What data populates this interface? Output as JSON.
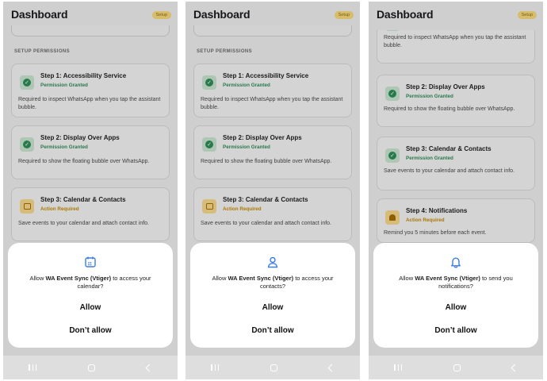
{
  "header": {
    "title": "Dashboard",
    "badge": "Setup"
  },
  "section_label": "SETUP PERMISSIONS",
  "steps": {
    "s1": {
      "title": "Step 1: Accessibility Service",
      "desc": "Required to inspect WhatsApp when you tap the assistant bubble."
    },
    "s2": {
      "title": "Step 2: Display Over Apps",
      "desc": "Required to show the floating bubble over WhatsApp."
    },
    "s3": {
      "title": "Step 3: Calendar & Contacts",
      "desc": "Save events to your calendar and attach contact info."
    },
    "s4": {
      "title": "Step 4: Notifications",
      "desc": "Remind you 5 minutes before each event."
    }
  },
  "status": {
    "granted": "Permission Granted",
    "required": "Action Required"
  },
  "dialogs": {
    "d1": {
      "prefix": "Allow ",
      "app": "WA Event Sync (Vtiger)",
      "suffix": " to access your calendar?",
      "icon": "calendar-icon"
    },
    "d2": {
      "prefix": "Allow ",
      "app": "WA Event Sync (Vtiger)",
      "suffix": " to access your contacts?",
      "icon": "person-icon"
    },
    "d3": {
      "prefix": "Allow ",
      "app": "WA Event Sync (Vtiger)",
      "suffix": " to send you notifications?",
      "icon": "bell-icon"
    }
  },
  "buttons": {
    "allow": "Allow",
    "deny": "Don’t allow"
  },
  "colors": {
    "granted": "#2e8b57",
    "required": "#c48a00",
    "accent": "#3b7de0"
  }
}
